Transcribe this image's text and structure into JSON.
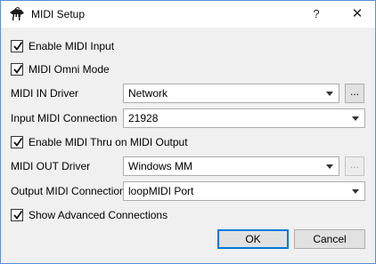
{
  "window": {
    "title": "MIDI Setup",
    "help_glyph": "?",
    "close_glyph": "✕",
    "icon": "piano-icon"
  },
  "options": {
    "enable_midi_input": {
      "label": "Enable MIDI Input",
      "checked": true
    },
    "midi_omni_mode": {
      "label": "MIDI Omni Mode",
      "checked": true
    },
    "enable_midi_thru": {
      "label": "Enable MIDI Thru on MIDI Output",
      "checked": true
    },
    "show_advanced": {
      "label": "Show Advanced Connections",
      "checked": true
    }
  },
  "fields": {
    "midi_in_driver": {
      "label": "MIDI IN Driver",
      "value": "Network"
    },
    "input_connection": {
      "label": "Input MIDI Connection",
      "value": "21928"
    },
    "midi_out_driver": {
      "label": "MIDI OUT Driver",
      "value": "Windows MM"
    },
    "output_connection": {
      "label": "Output MIDI Connection",
      "value": "loopMIDI Port"
    }
  },
  "dots_label": "...",
  "buttons": {
    "ok": "OK",
    "cancel": "Cancel"
  },
  "colors": {
    "accent": "#0078d7",
    "window_bg": "#f0f0f0"
  }
}
